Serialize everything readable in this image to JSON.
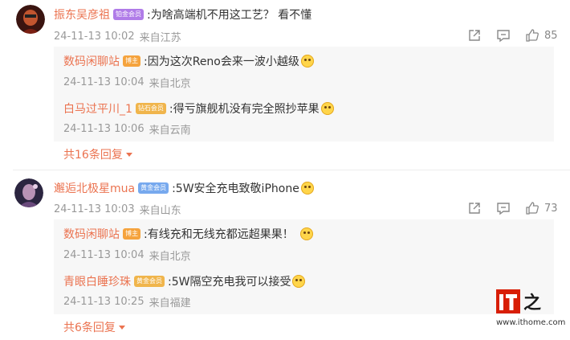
{
  "comments": [
    {
      "user": "振东吴彦祖",
      "badge": "铂金会员",
      "text": ":为啥高端机不用这工艺？ 看不懂",
      "time": "24-11-13 10:02",
      "location": "来自江苏",
      "likes": "85",
      "replies": [
        {
          "user": "数码闲聊站",
          "badge": "博主",
          "text": ":因为这次Reno会来一波小越级",
          "time": "24-11-13 10:04",
          "location": "来自北京"
        },
        {
          "user": "白马过平川_1",
          "badge": "钻石会员",
          "text": ":得亏旗舰机没有完全照抄苹果",
          "time": "24-11-13 10:06",
          "location": "来自云南"
        }
      ],
      "more_replies": "共16条回复"
    },
    {
      "user": "邂逅北极星mua",
      "badge": "黄金会员",
      "text": ":5W安全充电致敬iPhone",
      "time": "24-11-13 10:03",
      "location": "来自山东",
      "likes": "73",
      "replies": [
        {
          "user": "数码闲聊站",
          "badge": "博主",
          "text": ":有线充和无线充都远超果果！",
          "time": "24-11-13 10:04",
          "location": "来自北京"
        },
        {
          "user": "青眼白睡珍珠",
          "badge": "黄金会员",
          "text": ":5W隔空充电我可以接受",
          "time": "24-11-13 10:25",
          "location": "来自福建"
        }
      ],
      "more_replies": "共6条回复"
    }
  ],
  "watermark": {
    "logo_text": "IT之家",
    "url": "www.ithome.com"
  },
  "colors": {
    "username": "#eb7350",
    "meta": "#999999",
    "reply_bg": "#f7f7f7",
    "logo_red": "#d81e06"
  },
  "icons": [
    "share-icon",
    "comment-icon",
    "like-icon",
    "emoji-icon",
    "caret-down-icon"
  ]
}
